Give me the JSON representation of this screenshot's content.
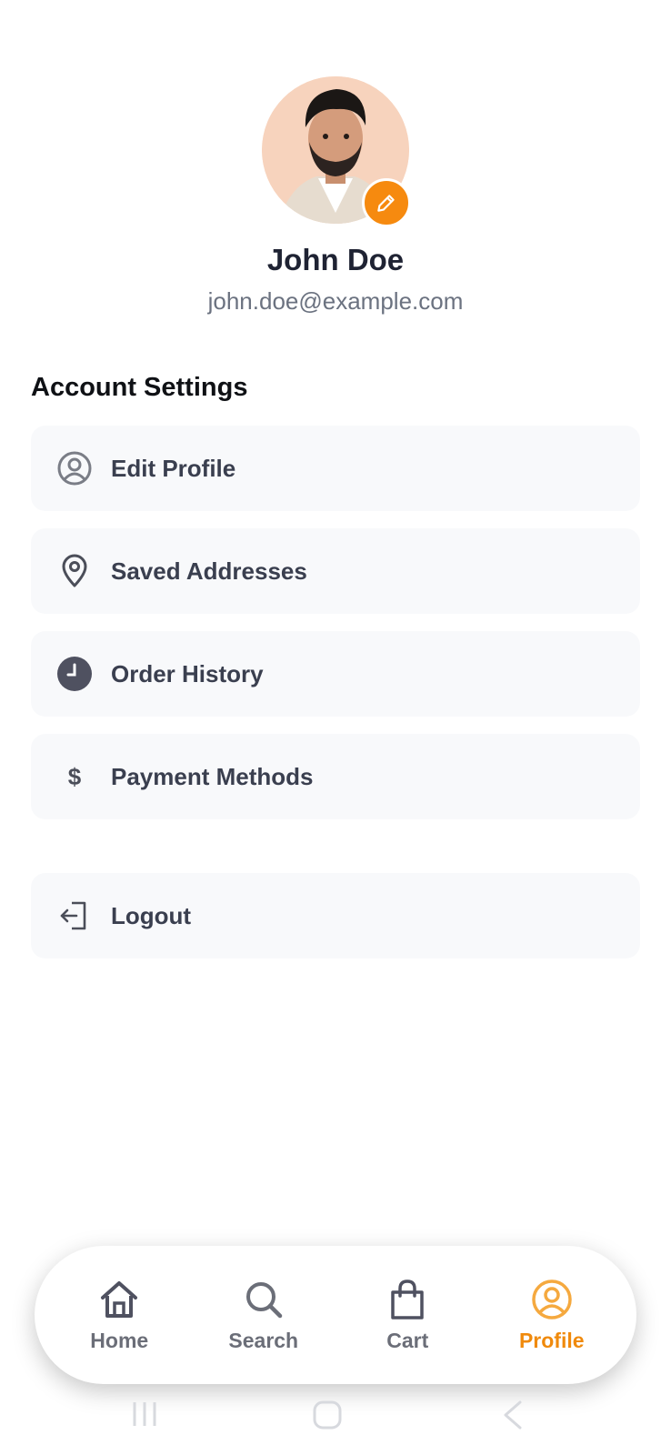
{
  "profile": {
    "name": "John Doe",
    "email": "john.doe@example.com"
  },
  "section_title": "Account Settings",
  "menu": [
    {
      "label": "Edit Profile",
      "icon": "user-circle-icon"
    },
    {
      "label": "Saved Addresses",
      "icon": "location-pin-icon"
    },
    {
      "label": "Order History",
      "icon": "clock-icon"
    },
    {
      "label": "Payment Methods",
      "icon": "dollar-icon"
    }
  ],
  "logout": {
    "label": "Logout",
    "icon": "logout-icon"
  },
  "bottom_nav": [
    {
      "label": "Home",
      "icon": "home-icon"
    },
    {
      "label": "Search",
      "icon": "search-icon"
    },
    {
      "label": "Cart",
      "icon": "shopping-bag-icon"
    },
    {
      "label": "Profile",
      "icon": "profile-icon",
      "active": true
    }
  ],
  "colors": {
    "accent": "#f68a0f",
    "card_bg": "#f8f9fb",
    "text_dark": "#1f2333",
    "text_muted": "#6b7280"
  }
}
